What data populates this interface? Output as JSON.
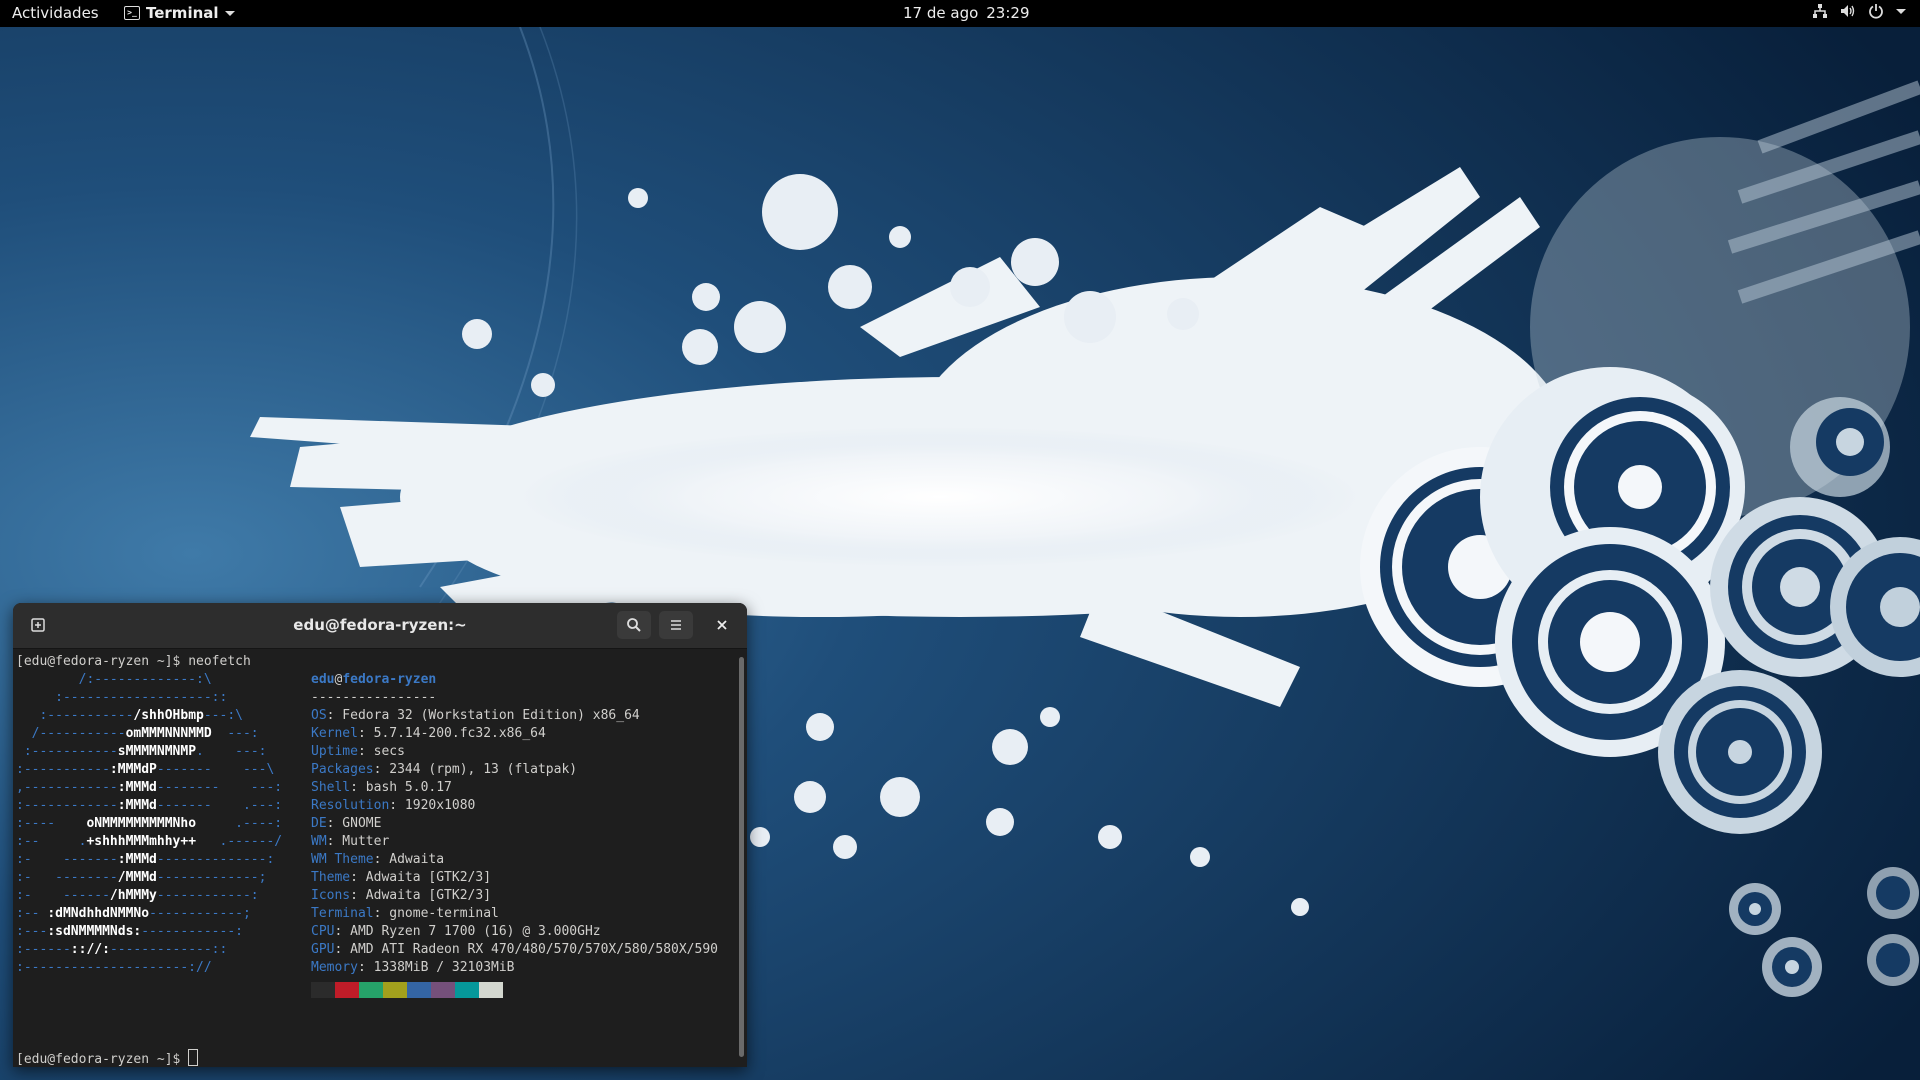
{
  "topbar": {
    "activities": "Actividades",
    "app_name": "Terminal",
    "app_icon_text": ">_",
    "date": "17 de ago",
    "time": "23:29",
    "icons": [
      "network-icon",
      "volume-icon",
      "power-icon",
      "chevron-down-icon"
    ]
  },
  "terminal": {
    "title": "edu@fedora-ryzen:~",
    "buttons": [
      "new-tab-icon",
      "search-icon",
      "hamburger-menu-icon",
      "close-icon"
    ],
    "prompt": "[edu@fedora-ryzen ~]$ ",
    "command": "neofetch",
    "user": "edu",
    "at": "@",
    "host": "fedora-ryzen",
    "separator": "----------------",
    "logo": [
      [
        "",
        "        /:-------------:\\"
      ],
      [
        "",
        "     :-------------------::"
      ],
      [
        "",
        "   :-----------",
        "/shhOHbmp",
        "---:\\"
      ],
      [
        "",
        "  /-----------",
        "omMMMNNNMMD",
        "  ---:"
      ],
      [
        "",
        " :-----------",
        "sMMMMNMNMP",
        ".    ---:"
      ],
      [
        "",
        ":-----------",
        ":MMMdP",
        "-------    ---\\"
      ],
      [
        "",
        ",------------",
        ":MMMd",
        "--------    ---:"
      ],
      [
        "",
        ":------------",
        ":MMMd",
        "-------    .---:"
      ],
      [
        "",
        ":----    ",
        "oNMMMMMMMMMNho",
        "     .----:"
      ],
      [
        "",
        ":--     .",
        "+shhhMMMmhhy++",
        "   .------/"
      ],
      [
        "",
        ":-    -------",
        ":MMMd",
        "--------------:"
      ],
      [
        "",
        ":-   --------",
        "/MMMd",
        "-------------;"
      ],
      [
        "",
        ":-    ------",
        "/hMMMy",
        "------------:"
      ],
      [
        "",
        ":-- ",
        ":dMNdhhdNMMNo",
        "------------;"
      ],
      [
        "",
        ":---",
        ":sdNMMMMNds:",
        "------------:"
      ],
      [
        "",
        ":------",
        ":://:",
        "-------------::"
      ],
      [
        "",
        ":---------------------://"
      ]
    ],
    "info": [
      {
        "key": "OS",
        "value": "Fedora 32 (Workstation Edition) x86_64"
      },
      {
        "key": "Kernel",
        "value": "5.7.14-200.fc32.x86_64"
      },
      {
        "key": "Uptime",
        "value": "secs"
      },
      {
        "key": "Packages",
        "value": "2344 (rpm), 13 (flatpak)"
      },
      {
        "key": "Shell",
        "value": "bash 5.0.17"
      },
      {
        "key": "Resolution",
        "value": "1920x1080"
      },
      {
        "key": "DE",
        "value": "GNOME"
      },
      {
        "key": "WM",
        "value": "Mutter"
      },
      {
        "key": "WM Theme",
        "value": "Adwaita"
      },
      {
        "key": "Theme",
        "value": "Adwaita [GTK2/3]"
      },
      {
        "key": "Icons",
        "value": "Adwaita [GTK2/3]"
      },
      {
        "key": "Terminal",
        "value": "gnome-terminal"
      },
      {
        "key": "CPU",
        "value": "AMD Ryzen 7 1700 (16) @ 3.000GHz"
      },
      {
        "key": "GPU",
        "value": "AMD ATI Radeon RX 470/480/570/570X/580/580X/590"
      },
      {
        "key": "Memory",
        "value": "1338MiB / 32103MiB"
      }
    ],
    "palette": [
      "#2b2b2b",
      "#c01c28",
      "#26a269",
      "#a2a01d",
      "#3465a4",
      "#75507b",
      "#06989a",
      "#d3d7cf"
    ]
  },
  "colors": {
    "wallpaper_dark": "#0b2745",
    "wallpaper_mid": "#2b5d8a",
    "splash": "#f2f5f8",
    "terminal_bg": "#1e1e1e",
    "accent": "#3b79c6"
  }
}
